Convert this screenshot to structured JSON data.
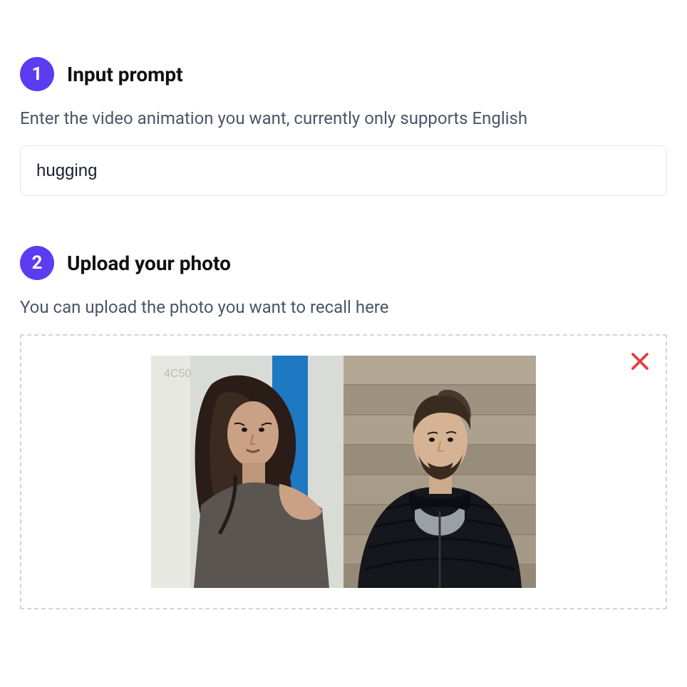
{
  "step1": {
    "number": "1",
    "title": "Input prompt",
    "description": "Enter the video animation you want, currently only supports English",
    "input_value": "hugging"
  },
  "step2": {
    "number": "2",
    "title": "Upload your photo",
    "description": "You can upload the photo you want to recall here"
  },
  "icons": {
    "close": "close-icon"
  },
  "colors": {
    "accent": "#5b3cf0",
    "close": "#e53e3e"
  }
}
